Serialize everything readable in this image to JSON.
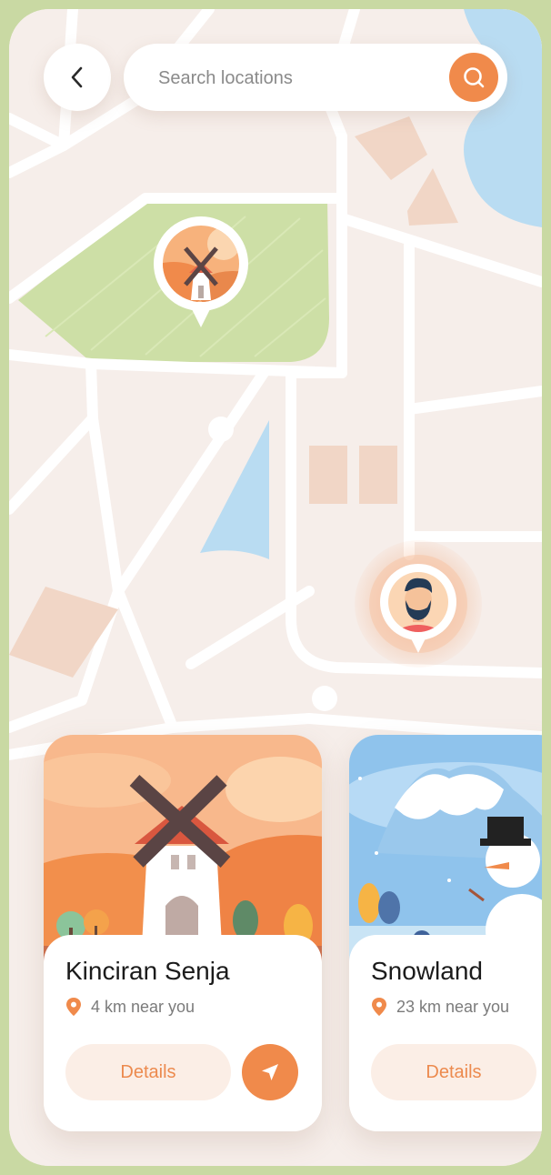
{
  "colors": {
    "accent": "#f08a4b",
    "map_background": "#f6eeea",
    "park": "#cddfa6",
    "water": "#b9dcf2",
    "buildings": "#f1d6c6",
    "details_background": "#fbeee6"
  },
  "header": {
    "back_icon": "chevron-left-icon",
    "search": {
      "placeholder": "Search locations",
      "value": "",
      "icon": "search-icon"
    }
  },
  "map": {
    "pins": [
      {
        "name": "windmill-location-pin",
        "icon": "windmill-icon"
      },
      {
        "name": "user-location-pin",
        "icon": "user-avatar"
      }
    ]
  },
  "cards": [
    {
      "title": "Kinciran Senja",
      "distance": "4 km near you",
      "distance_icon": "location-pin-icon",
      "details_label": "Details",
      "navigate_icon": "navigation-arrow-icon",
      "illustration": "windmill-sunset"
    },
    {
      "title": "Snowland",
      "distance": "23 km near you",
      "distance_icon": "location-pin-icon",
      "details_label": "Details",
      "illustration": "snowman-winter"
    }
  ]
}
